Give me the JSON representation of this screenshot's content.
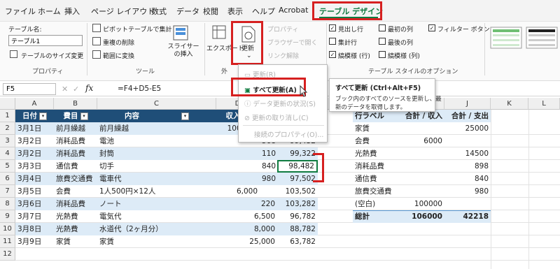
{
  "menubar": {
    "tabs": [
      "ファイル",
      "ホーム",
      "挿入",
      "ページ レイアウト",
      "数式",
      "データ",
      "校閲",
      "表示",
      "ヘルプ",
      "Acrobat",
      "テーブル デザイン"
    ]
  },
  "ribbon": {
    "table_name_label": "テーブル名:",
    "table_name_value": "テーブル1",
    "resize_label": "テーブルのサイズ変更",
    "group_properties": "プロパティ",
    "pivot_label": "ピボットテーブルで集計",
    "remove_dup_label": "重複の削除",
    "convert_range_label": "範囲に変換",
    "slicer_label": "スライサーの挿入",
    "group_tools": "ツール",
    "export_label": "エクスポート",
    "refresh_label": "更新",
    "properties_label": "プロパティ",
    "browser_label": "ブラウザーで開く",
    "unlink_label": "リンク解除",
    "group_external_short": "外",
    "header_row": "見出し行",
    "total_row": "集計行",
    "banded_rows": "縞模様 (行)",
    "first_col": "最初の列",
    "last_col": "最後の列",
    "banded_cols": "縞模様 (列)",
    "filter_btn": "フィルター ボタン",
    "group_style_options": "テーブル スタイルのオプション"
  },
  "formula": {
    "name_box": "F5",
    "fx": "fx",
    "formula": "=F4+D5-E5"
  },
  "dropdown": {
    "items": [
      "更新(R)",
      "すべて更新(A)",
      "データ更新の状況(S)",
      "更新の取り消し(C)",
      "接続のプロパティ(O)..."
    ]
  },
  "tooltip": {
    "title": "すべて更新 (Ctrl+Alt+F5)",
    "body1": "ブック内のすべてのソースを更新し、最",
    "body2": "新のデータを取得します。"
  },
  "columns": [
    "A",
    "B",
    "C",
    "D",
    "E",
    "F",
    "G",
    "H",
    "I",
    "J",
    "K",
    "L"
  ],
  "rows": [
    "1",
    "2",
    "3",
    "4",
    "5",
    "6",
    "7",
    "8",
    "9",
    "10",
    "11",
    "12"
  ],
  "table": {
    "headers": [
      "日付",
      "費目",
      "内容",
      "収入",
      "",
      "残高"
    ],
    "data": [
      [
        "3月1日",
        "前月繰越",
        "前月繰越",
        "100,000",
        "",
        ""
      ],
      [
        "3月2日",
        "消耗品費",
        "電池",
        "",
        "568",
        "99,432"
      ],
      [
        "3月2日",
        "消耗品費",
        "封筒",
        "",
        "110",
        "99,322"
      ],
      [
        "3月3日",
        "通信費",
        "切手",
        "",
        "840",
        "98,482"
      ],
      [
        "3月4日",
        "旅費交通費",
        "電車代",
        "",
        "980",
        "97,502"
      ],
      [
        "3月5日",
        "会費",
        "1人500円×12人",
        "6,000",
        "",
        "103,502"
      ],
      [
        "3月6日",
        "消耗品費",
        "ノート",
        "",
        "220",
        "103,282"
      ],
      [
        "3月7日",
        "光熱費",
        "電気代",
        "",
        "6,500",
        "96,782"
      ],
      [
        "3月8日",
        "光熱費",
        "水道代（2ヶ月分）",
        "",
        "8,000",
        "88,782"
      ],
      [
        "3月9日",
        "家賃",
        "家賃",
        "",
        "25,000",
        "63,782"
      ]
    ]
  },
  "pivot": {
    "headers": [
      "行ラベル",
      "合計 / 収入",
      "合計 / 支出"
    ],
    "rows": [
      [
        "家賃",
        "",
        "25000"
      ],
      [
        "会費",
        "6000",
        ""
      ],
      [
        "光熱費",
        "",
        "14500"
      ],
      [
        "消耗品費",
        "",
        "898"
      ],
      [
        "通信費",
        "",
        "840"
      ],
      [
        "旅費交通費",
        "",
        "980"
      ],
      [
        "(空白)",
        "100000",
        ""
      ]
    ],
    "total": [
      "総計",
      "106000",
      "42218"
    ]
  },
  "colors": {
    "accent": "#107c41",
    "header_fill": "#1f4e78",
    "band_fill": "#ddebf7",
    "red": "#d62020"
  }
}
